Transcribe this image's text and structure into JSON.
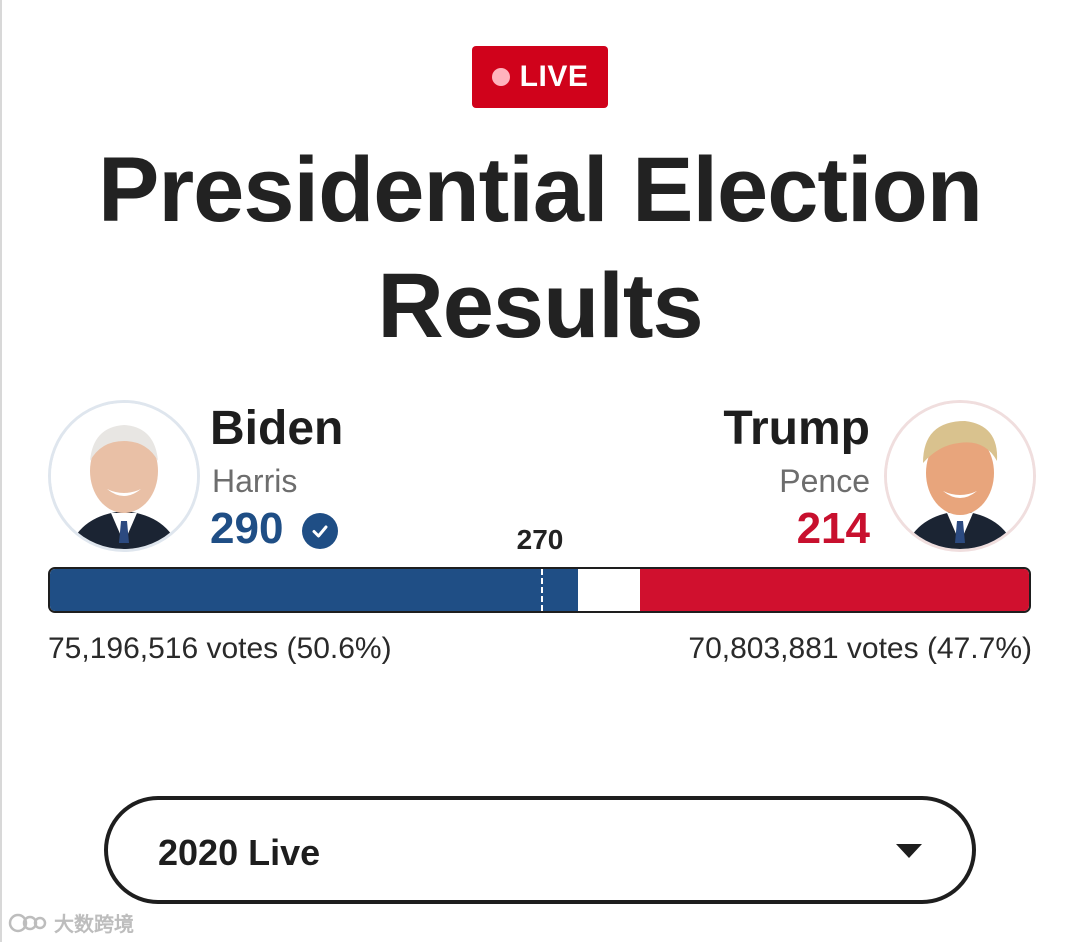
{
  "live_badge": {
    "label": "LIVE"
  },
  "page_title": "Presidential Election Results",
  "candidates": {
    "left": {
      "name": "Biden",
      "running_mate": "Harris",
      "electoral_votes": "290",
      "popular_votes": "75,196,516 votes (50.6%)",
      "color": "#1f4e85",
      "winner": true,
      "portrait": "biden-portrait"
    },
    "right": {
      "name": "Trump",
      "running_mate": "Pence",
      "electoral_votes": "214",
      "popular_votes": "70,803,881 votes (47.7%)",
      "color": "#c8102e",
      "winner": false,
      "portrait": "trump-portrait"
    }
  },
  "threshold": {
    "label": "270"
  },
  "electoral_bar": {
    "total": 538,
    "dem": 290,
    "rep": 214,
    "threshold": 270
  },
  "year_select": {
    "selected": "2020 Live",
    "icon": "caret-down-icon"
  },
  "watermark": {
    "text": "大数跨境"
  }
}
